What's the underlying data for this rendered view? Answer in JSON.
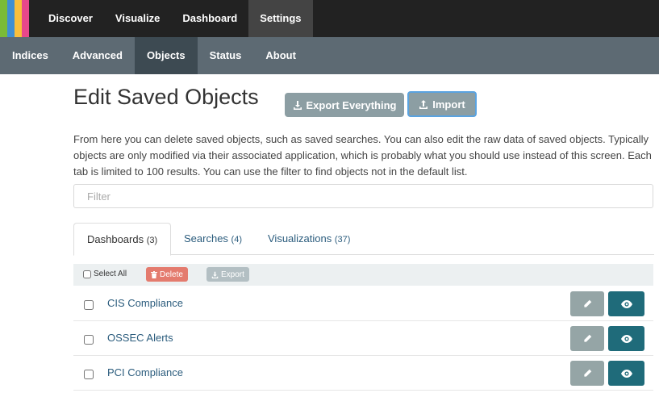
{
  "logo": {
    "stripes": [
      "#7abb37",
      "#3f8fd2",
      "#f9bf3b",
      "#e8488b"
    ]
  },
  "top_nav": [
    {
      "label": "Discover"
    },
    {
      "label": "Visualize"
    },
    {
      "label": "Dashboard"
    },
    {
      "label": "Settings",
      "active": true
    }
  ],
  "sub_nav": [
    {
      "label": "Indices"
    },
    {
      "label": "Advanced"
    },
    {
      "label": "Objects",
      "active": true
    },
    {
      "label": "Status"
    },
    {
      "label": "About"
    }
  ],
  "header": {
    "title": "Edit Saved Objects",
    "export_everything_label": "Export Everything",
    "import_label": "Import"
  },
  "description": "From here you can delete saved objects, such as saved searches. You can also edit the raw data of saved objects. Typically objects are only modified via their associated application, which is probably what you should use instead of this screen. Each tab is limited to 100 results. You can use the filter to find objects not in the default list.",
  "filter": {
    "placeholder": "Filter",
    "value": ""
  },
  "tabs": [
    {
      "label": "Dashboards",
      "count": "(3)",
      "active": true
    },
    {
      "label": "Searches",
      "count": "(4)"
    },
    {
      "label": "Visualizations",
      "count": "(37)"
    }
  ],
  "toolbar": {
    "select_all_label": "Select All",
    "delete_label": "Delete",
    "export_label": "Export"
  },
  "rows": [
    {
      "title": "CIS Compliance"
    },
    {
      "title": "OSSEC Alerts"
    },
    {
      "title": "PCI Compliance"
    }
  ],
  "colors": {
    "top_nav_bg": "#222222",
    "sub_nav_bg": "#5d6a73",
    "link": "#2b5c7d",
    "view_button": "#1f6b7a",
    "delete_button": "#e47b6e"
  },
  "icons": {
    "export_everything": "download-icon",
    "import": "upload-icon",
    "delete": "trash-icon",
    "export": "download-icon",
    "edit": "pencil-icon",
    "view": "eye-icon"
  }
}
